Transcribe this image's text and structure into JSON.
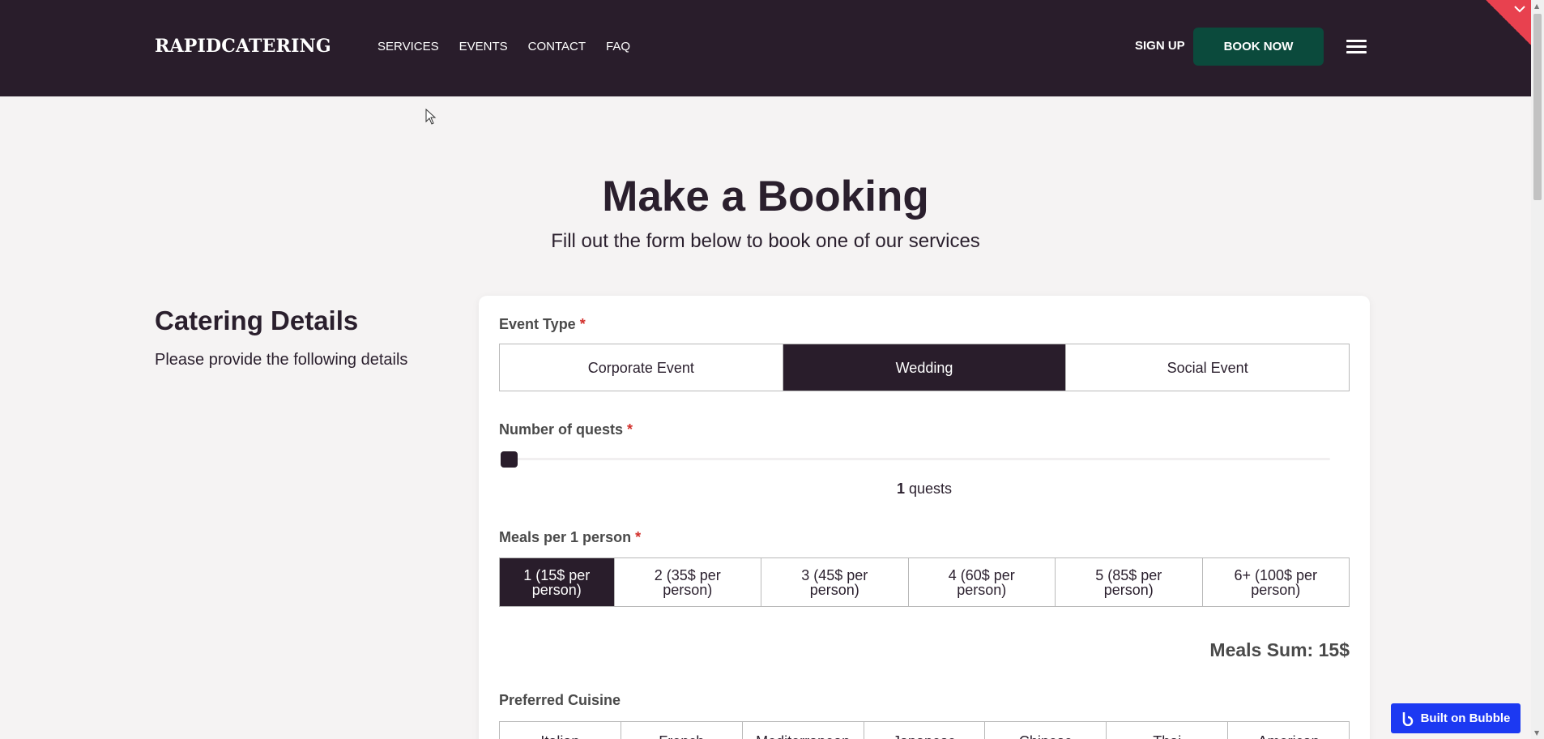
{
  "header": {
    "logo": "RAPIDCATERING",
    "nav": [
      "SERVICES",
      "EVENTS",
      "CONTACT",
      "FAQ"
    ],
    "signup_label": "SIGN UP",
    "book_now_label": "BOOK NOW"
  },
  "page": {
    "title": "Make a Booking",
    "subtitle": "Fill out the form below to book one of our services"
  },
  "side": {
    "title": "Catering Details",
    "subtitle": "Please provide the following details"
  },
  "form": {
    "event_type": {
      "label": "Event Type",
      "required_mark": "*",
      "options": [
        "Corporate Event",
        "Wedding",
        "Social Event"
      ],
      "selected": "Wedding"
    },
    "guests": {
      "label": "Number of quests",
      "required_mark": "*",
      "value": "1",
      "unit": "quests",
      "slider_fraction": 0.0
    },
    "meals": {
      "label": "Meals per 1 person",
      "required_mark": "*",
      "options": [
        "1 (15$ per person)",
        "2 (35$ per person)",
        "3 (45$ per person)",
        "4 (60$ per person)",
        "5 (85$ per person)",
        "6+ (100$ per person)"
      ],
      "selected": "1 (15$ per person)"
    },
    "meals_sum": "Meals Sum: 15$",
    "cuisine": {
      "label": "Preferred Cuisine",
      "options": [
        "Italian",
        "French",
        "Mediterranean",
        "Japanese",
        "Chinese",
        "Thai",
        "American"
      ]
    }
  },
  "badge": {
    "label": "Built on Bubble"
  },
  "colors": {
    "header_bg": "#291d2b",
    "accent": "#0b4a3c",
    "required": "#d2302c",
    "bubble": "#1c39f2"
  }
}
